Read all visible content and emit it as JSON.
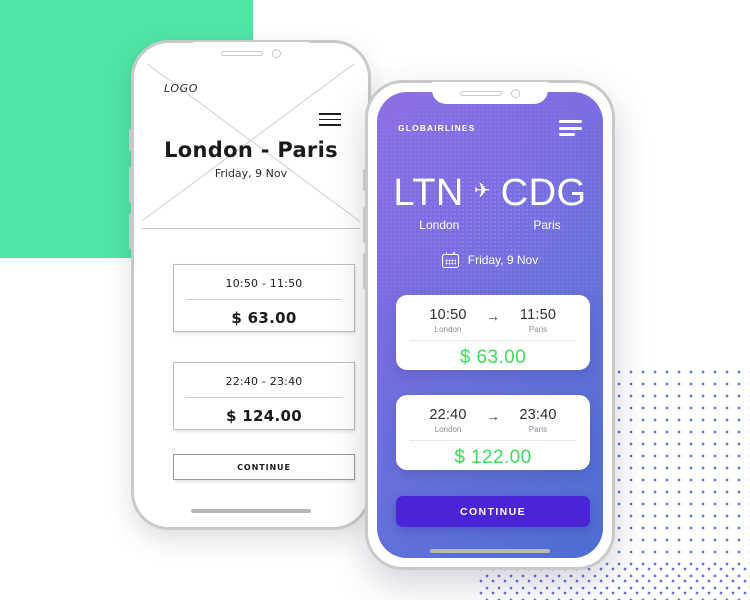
{
  "background": {
    "green_block_color": "#4fe5a5",
    "dot_pattern_color": "#5b72e0"
  },
  "wireframe_phone": {
    "logo": "LOGO",
    "menu_icon": "hamburger-menu-icon",
    "title": "London - Paris",
    "date": "Friday, 9 Nov",
    "flights": [
      {
        "times": "10:50 - 11:50",
        "price": "$ 63.00"
      },
      {
        "times": "22:40 - 23:40",
        "price": "$ 124.00"
      }
    ],
    "continue_label": "CONTINUE"
  },
  "color_phone": {
    "brand": "GLOBAIRLINES",
    "menu_icon": "hamburger-menu-icon",
    "route": {
      "origin_code": "LTN",
      "plane_icon": "✈",
      "destination_code": "CDG",
      "origin_city": "London",
      "destination_city": "Paris"
    },
    "date": "Friday, 9 Nov",
    "calendar_icon": "calendar-icon",
    "flights": [
      {
        "depart_time": "10:50",
        "depart_city": "London",
        "arrow": "→",
        "arrive_time": "11:50",
        "arrive_city": "Paris",
        "price": "$ 63.00"
      },
      {
        "depart_time": "22:40",
        "depart_city": "London",
        "arrow": "→",
        "arrive_time": "23:40",
        "arrive_city": "Paris",
        "price": "$ 122.00"
      }
    ],
    "continue_label": "CONTINUE",
    "colors": {
      "gradient_start": "#8e6fe4",
      "gradient_end": "#4c6ed2",
      "price_green": "#3ddc5a",
      "button_purple": "#4a24d6"
    }
  }
}
